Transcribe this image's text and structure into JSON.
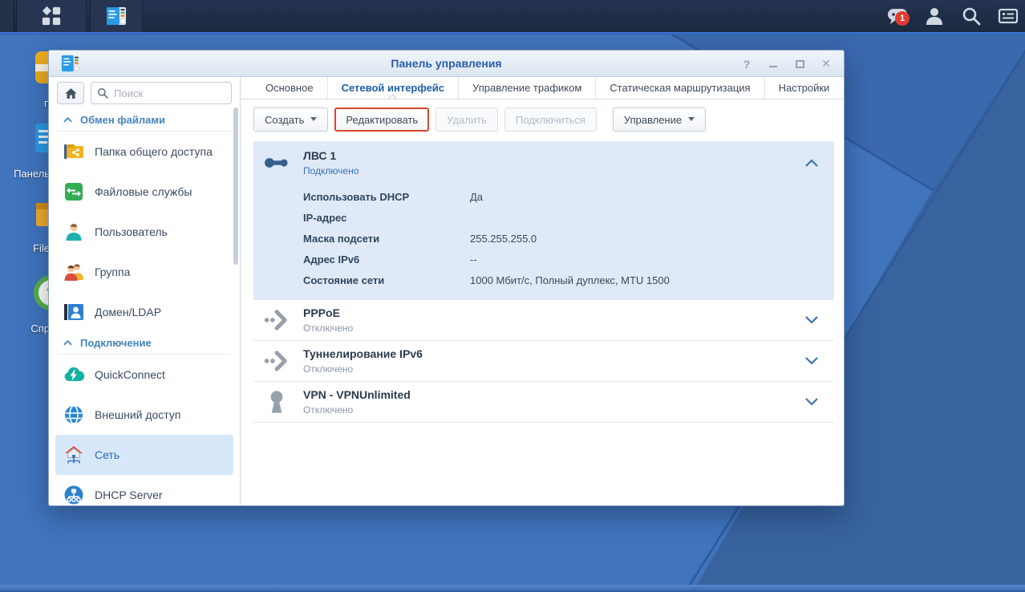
{
  "taskbar": {
    "notification_badge": "1"
  },
  "desktop": {
    "icons": [
      {
        "label": "п"
      },
      {
        "label": "Панель"
      },
      {
        "label": "File"
      },
      {
        "label": "Спр"
      }
    ]
  },
  "window": {
    "title": "Панель управления",
    "controls": {
      "help": "?",
      "close": "✕"
    },
    "sidebar": {
      "search_placeholder": "Поиск",
      "sections": [
        {
          "header": "Обмен файлами",
          "items": [
            {
              "label": "Папка общего доступа"
            },
            {
              "label": "Файловые службы"
            },
            {
              "label": "Пользователь"
            },
            {
              "label": "Группа"
            },
            {
              "label": "Домен/LDAP"
            }
          ]
        },
        {
          "header": "Подключение",
          "items": [
            {
              "label": "QuickConnect"
            },
            {
              "label": "Внешний доступ"
            },
            {
              "label": "Сеть",
              "selected": true
            },
            {
              "label": "DHCP Server"
            }
          ]
        }
      ]
    },
    "tabs": [
      {
        "label": "Основное"
      },
      {
        "label": "Сетевой интерфейс",
        "active": true
      },
      {
        "label": "Управление трафиком"
      },
      {
        "label": "Статическая маршрутизация"
      },
      {
        "label": "Настройки"
      }
    ],
    "toolbar": {
      "create": "Создать",
      "edit": "Редактировать",
      "delete": "Удалить",
      "connect": "Подключиться",
      "manage": "Управление"
    },
    "interfaces": [
      {
        "name": "ЛВС 1",
        "status": "Подключено",
        "expanded": true,
        "details": [
          {
            "label": "Использовать DHCP",
            "value": "Да"
          },
          {
            "label": "IP-адрес",
            "value": ""
          },
          {
            "label": "Маска подсети",
            "value": "255.255.255.0"
          },
          {
            "label": "Адрес IPv6",
            "value": "--"
          },
          {
            "label": "Состояние сети",
            "value": "1000 Мбит/с, Полный дуплекс, MTU 1500"
          }
        ]
      },
      {
        "name": "PPPoE",
        "status": "Отключено"
      },
      {
        "name": "Туннелирование IPv6",
        "status": "Отключено"
      },
      {
        "name": "VPN - VPNUnlimited",
        "status": "Отключено"
      }
    ]
  },
  "colors": {
    "accent": "#2163a8",
    "highlight_border": "#d5492a",
    "selected_bg": "#d6e7fa",
    "panel_bg": "#dfe9f8",
    "connected_text": "#3573b5",
    "disabled_text": "#8c97a3"
  }
}
